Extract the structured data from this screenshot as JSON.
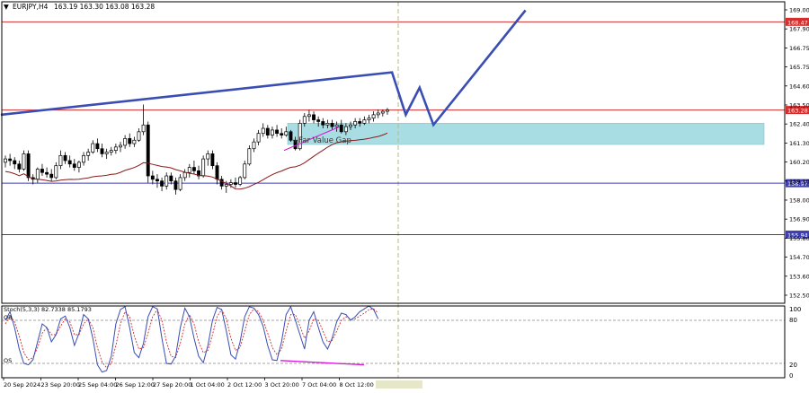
{
  "header": {
    "symbol": "EURJPY,H4",
    "ohlc": "163.19 163.30 163.08 163.28"
  },
  "indicator": {
    "title": "Stoch(5,3,3) 82.7338 85.1793",
    "ob_label": "OB",
    "os_label": "OS",
    "y_labels": [
      "100",
      "80",
      "20",
      "0"
    ]
  },
  "annotation": {
    "fvg_label": "+Far Value Gap"
  },
  "colors": {
    "candle": "#000000",
    "ma": "#8b1a1a",
    "projection": "#3a4db3",
    "fvg_zone": "#a8dde3",
    "resistance_line": "#d32f2f",
    "support_line": "#3f3fb0",
    "stoch_main": "#3a4db3",
    "stoch_signal": "#d32f2f",
    "divergence": "#d81bd8",
    "grid": "#888888"
  },
  "chart_data": {
    "type": "candlestick",
    "price_axis": {
      "ylim": [
        151.9,
        169.65
      ],
      "ticks": [
        "169.00",
        "167.90",
        "166.75",
        "165.75",
        "164.60",
        "163.50",
        "162.40",
        "161.30",
        "160.20",
        "159.10",
        "158.00",
        "156.90",
        "155.80",
        "154.70",
        "153.60",
        "152.50"
      ]
    },
    "time_axis": {
      "labels": [
        "20 Sep 2024",
        "23 Sep 20:00",
        "25 Sep 04:00",
        "26 Sep 12:00",
        "27 Sep 20:00",
        "1 Oct 04:00",
        "2 Oct 12:00",
        "3 Oct 20:00",
        "7 Oct 04:00",
        "8 Oct 12:00"
      ]
    },
    "levels": [
      {
        "price": 168.47,
        "label": "168.47",
        "kind": "resistance"
      },
      {
        "price": 163.28,
        "label": "163.28",
        "kind": "resistance"
      },
      {
        "price": 158.97,
        "label": "158.97",
        "kind": "support"
      },
      {
        "price": 155.94,
        "label": "155.94",
        "kind": "support"
      }
    ],
    "zone": {
      "top": 162.5,
      "bottom": 161.25
    },
    "candles": [
      [
        160.2,
        160.6,
        159.9,
        160.4
      ],
      [
        160.4,
        160.7,
        160.0,
        160.3
      ],
      [
        160.3,
        160.5,
        159.8,
        160.1
      ],
      [
        160.1,
        160.3,
        159.6,
        159.8
      ],
      [
        159.8,
        160.9,
        159.7,
        160.7
      ],
      [
        160.7,
        160.9,
        159.1,
        159.3
      ],
      [
        159.3,
        159.5,
        158.9,
        159.2
      ],
      [
        159.2,
        159.9,
        159.0,
        159.8
      ],
      [
        159.8,
        160.1,
        159.4,
        159.6
      ],
      [
        159.6,
        159.9,
        159.3,
        159.5
      ],
      [
        159.5,
        159.8,
        159.1,
        159.3
      ],
      [
        159.3,
        160.2,
        159.2,
        160.0
      ],
      [
        160.0,
        160.9,
        159.8,
        160.6
      ],
      [
        160.6,
        160.8,
        160.1,
        160.3
      ],
      [
        160.3,
        160.6,
        159.9,
        160.1
      ],
      [
        160.1,
        160.4,
        159.7,
        159.9
      ],
      [
        159.9,
        160.3,
        159.6,
        160.2
      ],
      [
        160.2,
        160.8,
        160.0,
        160.6
      ],
      [
        160.6,
        161.0,
        160.3,
        160.8
      ],
      [
        160.8,
        161.5,
        160.7,
        161.3
      ],
      [
        161.3,
        161.6,
        160.8,
        161.0
      ],
      [
        161.0,
        161.3,
        160.5,
        160.7
      ],
      [
        160.7,
        161.0,
        160.4,
        160.8
      ],
      [
        160.8,
        161.1,
        160.6,
        160.9
      ],
      [
        160.9,
        161.3,
        160.7,
        161.1
      ],
      [
        161.1,
        161.4,
        160.8,
        161.2
      ],
      [
        161.2,
        161.8,
        161.0,
        161.6
      ],
      [
        161.6,
        161.9,
        161.1,
        161.3
      ],
      [
        161.3,
        161.7,
        161.1,
        161.5
      ],
      [
        161.5,
        162.2,
        161.4,
        162.0
      ],
      [
        162.0,
        163.6,
        161.8,
        162.4
      ],
      [
        162.4,
        162.6,
        159.0,
        159.4
      ],
      [
        159.4,
        159.7,
        158.9,
        159.2
      ],
      [
        159.2,
        159.5,
        158.7,
        159.1
      ],
      [
        159.1,
        159.3,
        158.5,
        158.8
      ],
      [
        158.8,
        159.6,
        158.6,
        159.4
      ],
      [
        159.4,
        159.6,
        158.9,
        159.1
      ],
      [
        159.1,
        159.3,
        158.3,
        158.6
      ],
      [
        158.6,
        159.5,
        158.5,
        159.3
      ],
      [
        159.3,
        159.8,
        159.1,
        159.6
      ],
      [
        159.6,
        160.1,
        159.3,
        159.9
      ],
      [
        159.9,
        160.3,
        159.5,
        159.7
      ],
      [
        159.7,
        160.0,
        159.2,
        159.4
      ],
      [
        159.4,
        160.6,
        159.3,
        160.4
      ],
      [
        160.4,
        160.9,
        160.0,
        160.7
      ],
      [
        160.7,
        160.9,
        159.8,
        160.0
      ],
      [
        160.0,
        160.2,
        158.9,
        159.2
      ],
      [
        159.2,
        159.4,
        158.6,
        158.8
      ],
      [
        158.8,
        159.1,
        158.4,
        158.9
      ],
      [
        158.9,
        159.2,
        158.7,
        159.0
      ],
      [
        159.0,
        159.3,
        158.7,
        158.9
      ],
      [
        158.9,
        159.4,
        158.8,
        159.3
      ],
      [
        159.3,
        160.3,
        159.2,
        160.1
      ],
      [
        160.1,
        161.2,
        160.0,
        161.0
      ],
      [
        161.0,
        161.6,
        160.8,
        161.4
      ],
      [
        161.4,
        162.1,
        161.2,
        161.9
      ],
      [
        161.9,
        162.5,
        161.7,
        162.2
      ],
      [
        162.2,
        162.4,
        161.6,
        161.8
      ],
      [
        161.8,
        162.3,
        161.6,
        162.1
      ],
      [
        162.1,
        162.4,
        161.7,
        161.9
      ],
      [
        161.9,
        162.2,
        161.6,
        161.8
      ],
      [
        161.8,
        162.3,
        161.7,
        162.0
      ],
      [
        162.0,
        162.1,
        161.4,
        161.5
      ],
      [
        161.5,
        161.7,
        160.9,
        161.0
      ],
      [
        161.0,
        162.7,
        160.9,
        162.5
      ],
      [
        162.5,
        163.1,
        162.3,
        162.9
      ],
      [
        162.9,
        163.3,
        162.6,
        163.0
      ],
      [
        163.0,
        163.2,
        162.5,
        162.7
      ],
      [
        162.7,
        162.9,
        162.3,
        162.6
      ],
      [
        162.6,
        162.8,
        162.2,
        162.4
      ],
      [
        162.4,
        162.7,
        162.2,
        162.5
      ],
      [
        162.5,
        162.7,
        162.1,
        162.3
      ],
      [
        162.3,
        162.6,
        162.0,
        162.4
      ],
      [
        162.4,
        162.7,
        161.9,
        162.0
      ],
      [
        162.0,
        162.5,
        161.8,
        162.3
      ],
      [
        162.3,
        162.6,
        162.1,
        162.4
      ],
      [
        162.4,
        162.8,
        162.2,
        162.6
      ],
      [
        162.6,
        162.8,
        162.3,
        162.5
      ],
      [
        162.5,
        162.9,
        162.4,
        162.7
      ],
      [
        162.7,
        163.0,
        162.5,
        162.8
      ],
      [
        162.8,
        163.2,
        162.6,
        163.0
      ],
      [
        163.0,
        163.3,
        162.8,
        163.1
      ],
      [
        163.1,
        163.3,
        162.9,
        163.2
      ],
      [
        163.2,
        163.4,
        163.0,
        163.28
      ]
    ],
    "projection": [
      [
        -1,
        163.0
      ],
      [
        84,
        165.5
      ],
      [
        87,
        163.0
      ],
      [
        90,
        164.6
      ],
      [
        93,
        162.4
      ],
      [
        113,
        169.15
      ]
    ],
    "stochastic": {
      "ylim": [
        0,
        100
      ],
      "ob": 80,
      "os": 20,
      "main": [
        80,
        92,
        70,
        40,
        20,
        18,
        25,
        50,
        75,
        70,
        50,
        60,
        82,
        86,
        70,
        45,
        62,
        88,
        82,
        55,
        18,
        8,
        10,
        30,
        75,
        95,
        99,
        70,
        35,
        28,
        48,
        85,
        99,
        96,
        55,
        20,
        19,
        30,
        70,
        97,
        85,
        55,
        30,
        21,
        45,
        80,
        98,
        95,
        65,
        32,
        26,
        50,
        85,
        99,
        97,
        88,
        72,
        45,
        25,
        24,
        50,
        88,
        99,
        80,
        60,
        40,
        80,
        92,
        70,
        50,
        40,
        55,
        78,
        90,
        88,
        80,
        85,
        92,
        96,
        100,
        95,
        82
      ],
      "signal": [
        75,
        86,
        78,
        58,
        35,
        25,
        28,
        42,
        62,
        70,
        60,
        60,
        72,
        82,
        78,
        60,
        60,
        75,
        82,
        70,
        42,
        22,
        14,
        20,
        45,
        75,
        92,
        85,
        58,
        40,
        42,
        62,
        85,
        95,
        80,
        50,
        30,
        28,
        48,
        75,
        88,
        75,
        50,
        35,
        38,
        60,
        85,
        95,
        82,
        55,
        38,
        42,
        65,
        88,
        96,
        92,
        80,
        62,
        42,
        32,
        40,
        65,
        88,
        88,
        72,
        55,
        65,
        82,
        80,
        65,
        50,
        52,
        65,
        80,
        85,
        82,
        82,
        86,
        90,
        95,
        96,
        90
      ]
    }
  }
}
